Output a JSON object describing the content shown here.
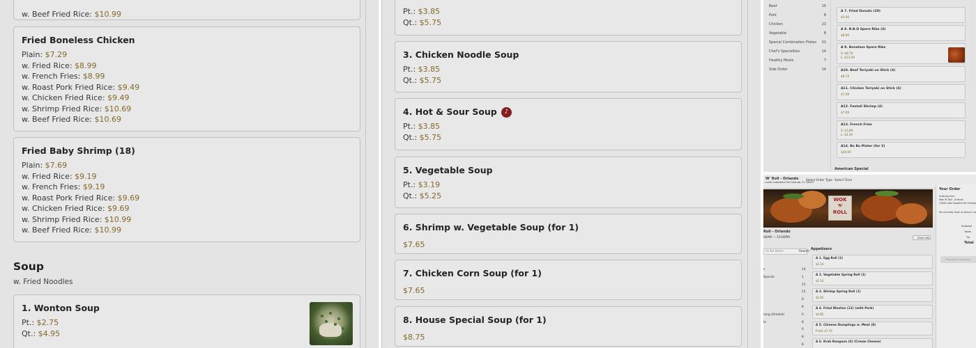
{
  "panel1": {
    "beef_top": {
      "label": "w. Beef Fried Rice: ",
      "price": "$10.99"
    },
    "chicken": {
      "title": "Fried Boneless Chicken",
      "rows": [
        {
          "label": "Plain: ",
          "price": "$7.29"
        },
        {
          "label": "w. Fried Rice: ",
          "price": "$8.99"
        },
        {
          "label": "w. French Fries: ",
          "price": "$8.99"
        },
        {
          "label": "w. Roast Pork Fried Rice: ",
          "price": "$9.49"
        },
        {
          "label": "w. Chicken Fried Rice: ",
          "price": "$9.49"
        },
        {
          "label": "w. Shrimp Fried Rice: ",
          "price": "$10.69"
        },
        {
          "label": "w. Beef Fried Rice: ",
          "price": "$10.69"
        }
      ]
    },
    "shrimp": {
      "title": "Fried Baby Shrimp (18)",
      "rows": [
        {
          "label": "Plain: ",
          "price": "$7.69"
        },
        {
          "label": "w. Fried Rice: ",
          "price": "$9.19"
        },
        {
          "label": "w. French Fries: ",
          "price": "$9.19"
        },
        {
          "label": "w. Roast Pork Fried Rice: ",
          "price": "$9.69"
        },
        {
          "label": "w. Chicken Fried Rice: ",
          "price": "$9.69"
        },
        {
          "label": "w. Shrimp Fried Rice: ",
          "price": "$10.99"
        },
        {
          "label": "w. Beef Fried Rice: ",
          "price": "$10.99"
        }
      ]
    },
    "section": {
      "title": "Soup",
      "subtitle": "w. Fried Noodles"
    },
    "wonton": {
      "title": "1. Wonton Soup",
      "rows": [
        {
          "label": "Pt.: ",
          "price": "$2.75"
        },
        {
          "label": "Qt.: ",
          "price": "$4.95"
        }
      ]
    }
  },
  "panel2": {
    "top_card": {
      "rows": [
        {
          "label": "Pt.: ",
          "price": "$3.85"
        },
        {
          "label": "Qt.: ",
          "price": "$5.75"
        }
      ]
    },
    "chicken_noodle": {
      "title": "3. Chicken Noodle Soup",
      "rows": [
        {
          "label": "Pt.: ",
          "price": "$3.85"
        },
        {
          "label": "Qt.: ",
          "price": "$5.75"
        }
      ]
    },
    "hot_sour": {
      "title": "4. Hot & Sour Soup",
      "rows": [
        {
          "label": "Pt.: ",
          "price": "$3.85"
        },
        {
          "label": "Qt.: ",
          "price": "$5.75"
        }
      ]
    },
    "vegetable": {
      "title": "5. Vegetable Soup",
      "rows": [
        {
          "label": "Pt.: ",
          "price": "$3.19"
        },
        {
          "label": "Qt.: ",
          "price": "$5.25"
        }
      ]
    },
    "shrimp_veg": {
      "title": "6. Shrimp w. Vegetable Soup (for 1)",
      "price": "$7.65"
    },
    "chicken_corn": {
      "title": "7. Chicken Corn Soup (for 1)",
      "price": "$7.65"
    },
    "house_special": {
      "title": "8. House Special Soup (for 1)",
      "price": "$8.75"
    }
  },
  "panel3": {
    "categories": [
      {
        "label": "Beef",
        "count": "15"
      },
      {
        "label": "Pork",
        "count": "8"
      },
      {
        "label": "Chicken",
        "count": "23"
      },
      {
        "label": "Vegetable",
        "count": "8"
      },
      {
        "label": "Special Combination Plates",
        "count": "31"
      },
      {
        "label": "Chef's Specialties",
        "count": "14"
      },
      {
        "label": "Healthy Meals",
        "count": "7"
      },
      {
        "label": "Side Order",
        "count": "14"
      }
    ],
    "items": [
      {
        "title": "A 7. Fried Donuts (20)",
        "p1": "$5.00",
        "p2": ""
      },
      {
        "title": "A 8. B.B.Q Spare Ribs (6)",
        "p1": "$8.00",
        "p2": ""
      },
      {
        "title": "A 9. Boneless Spare Ribs",
        "p1": "S: $8.79",
        "p2": "L: $13.59"
      },
      {
        "title": "A10. Beef Teriyaki on Stick (4)",
        "p1": "$8.19",
        "p2": ""
      },
      {
        "title": "A11. Chicken Teriyaki on Stick (4)",
        "p1": "$7.49",
        "p2": ""
      },
      {
        "title": "A12. Fantail Shrimp (4)",
        "p1": "$7.69",
        "p2": ""
      },
      {
        "title": "A13. French Fries",
        "p1": "S: $3.89",
        "p2": "L: $5.29"
      },
      {
        "title": "A14. Bo Bo Plater (for 2)",
        "p1": "$24.59",
        "p2": ""
      }
    ],
    "section": "American Special"
  },
  "panel4": {
    "restaurant": "W' Roll - Orlando",
    "address": "...ivate Lakeshore Rd Orlando, FL 32819",
    "order_type": "Select Order Type",
    "time": "Select Time",
    "your_order": "Your Order",
    "logo_words": [
      "WOK",
      "'N'",
      "ROLL"
    ],
    "name_line": "Roll - Orlando",
    "hours_line": "00AM — 10:00PM",
    "share_info": "Store info",
    "search_placeholder": "ch for items",
    "search_button": "Search",
    "appetizers": "Appetizers",
    "side_categories": [
      {
        "label": "s",
        "count": "14"
      },
      {
        "label": "Special",
        "count": "1"
      },
      {
        "label": "",
        "count": "15"
      },
      {
        "label": "",
        "count": "12"
      },
      {
        "label": "",
        "count": "8"
      },
      {
        "label": "",
        "count": "8"
      },
      {
        "label": "rong (Omelet)",
        "count": "6"
      },
      {
        "label": "ts",
        "count": "8"
      },
      {
        "label": "",
        "count": "6"
      },
      {
        "label": "",
        "count": "8"
      },
      {
        "label": "",
        "count": "8"
      },
      {
        "label": "",
        "count": "7"
      }
    ],
    "items": [
      {
        "title": "A 1. Egg Roll (1)",
        "p": "$2.10"
      },
      {
        "title": "A 2. Vegetable Spring Roll (1)",
        "p": "$2.10"
      },
      {
        "title": "A 3. Shrimp Spring Roll (1)",
        "p": "$2.65"
      },
      {
        "title": "A 4. Fried Wonton (12) (with Pork)",
        "p": "$4.85"
      },
      {
        "title": "A 5. Chinese Dumplings w. Meat (8)",
        "p": "Fried: $7.79"
      },
      {
        "title": "A 6. Krab Rangoon (6) (Cream Cheese)",
        "p": ""
      }
    ],
    "order_lines": [
      "Ordering from",
      "Wok 'N' Roll - Orlando",
      "12000 Lake Underhill Rd Orlando, FL",
      "You currently have no items in you..."
    ],
    "subtotal": "Subtotal",
    "taxes": "Taxes",
    "tip": "Tip",
    "total": "Total",
    "checkout": "Proceed to checkout"
  }
}
